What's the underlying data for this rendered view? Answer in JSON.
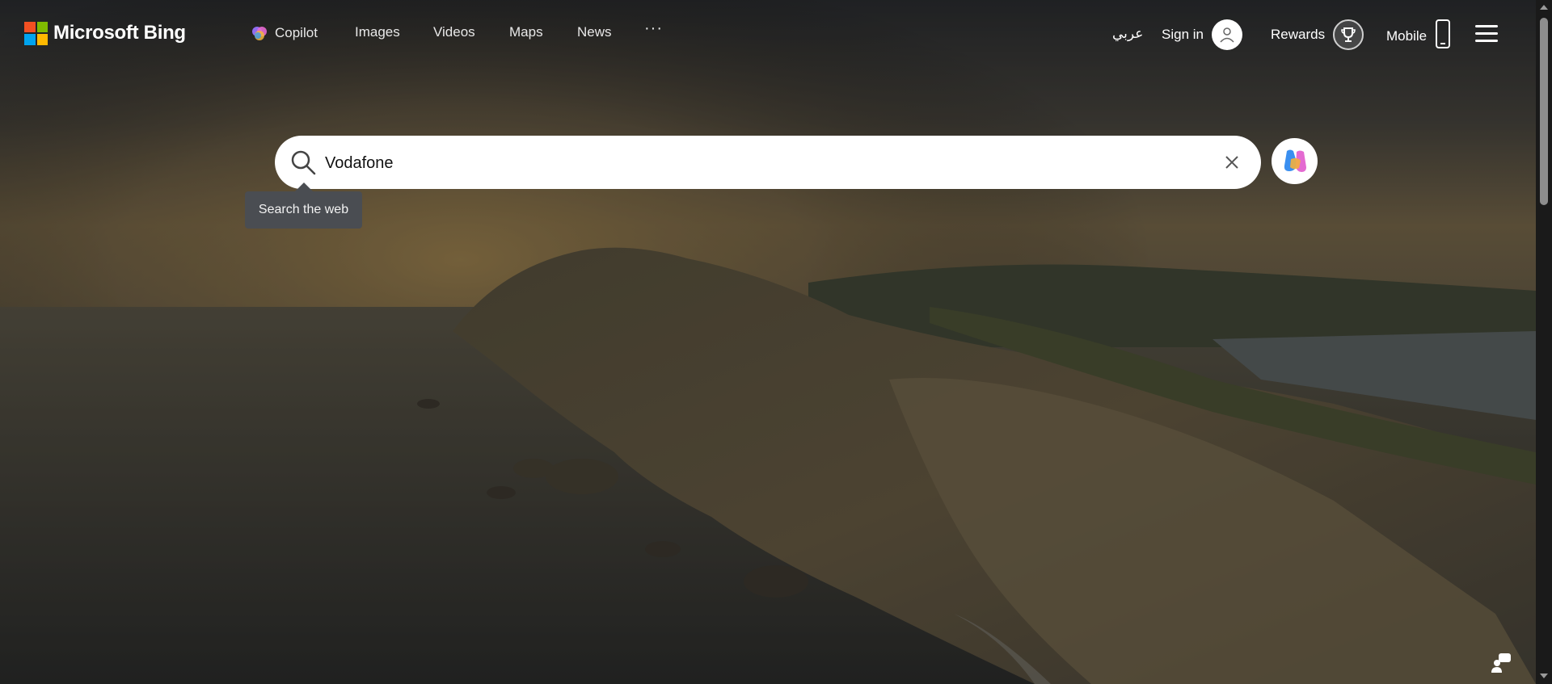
{
  "header": {
    "logo_text": "Microsoft Bing",
    "nav": [
      {
        "label": "Copilot",
        "icon": "copilot-icon"
      },
      {
        "label": "Images"
      },
      {
        "label": "Videos"
      },
      {
        "label": "Maps"
      },
      {
        "label": "News"
      }
    ],
    "more_label": "···",
    "language_label": "عربي",
    "sign_in_label": "Sign in",
    "rewards_label": "Rewards",
    "mobile_label": "Mobile"
  },
  "search": {
    "value": "Vodafone",
    "tooltip": "Search the web"
  },
  "icons": {
    "logo": "microsoft-logo-icon",
    "search": "search-icon",
    "clear": "close-icon",
    "copilot": "copilot-icon",
    "avatar": "user-avatar-icon",
    "rewards": "trophy-icon",
    "mobile": "phone-icon",
    "menu": "hamburger-menu-icon",
    "feedback": "feedback-icon"
  },
  "colors": {
    "ms_red": "#f25022",
    "ms_green": "#7fba00",
    "ms_blue": "#00a4ef",
    "ms_yellow": "#ffb900",
    "tooltip_bg": "#4a4d52"
  }
}
